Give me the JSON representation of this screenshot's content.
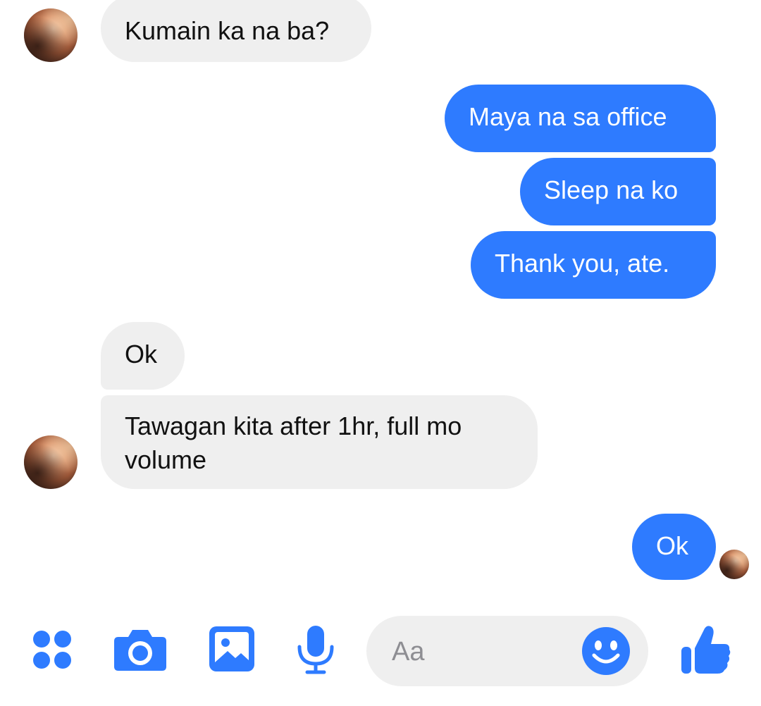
{
  "conversation": {
    "messages": [
      {
        "sender": "contact",
        "text": "Kumain ka na ba?"
      },
      {
        "sender": "me",
        "text": "Maya na sa office"
      },
      {
        "sender": "me",
        "text": "Sleep na ko"
      },
      {
        "sender": "me",
        "text": "Thank you, ate."
      },
      {
        "sender": "contact",
        "text": "Ok"
      },
      {
        "sender": "contact",
        "text": "Tawagan kita after 1hr, full mo"
      },
      {
        "sender": "contact",
        "text": "volume"
      },
      {
        "sender": "me",
        "text": "Ok"
      }
    ]
  },
  "composer": {
    "placeholder": "Aa"
  },
  "toolbar": {
    "icons": [
      "apps-icon",
      "camera-icon",
      "photo-icon",
      "microphone-icon",
      "emoji-icon",
      "thumbs-up-icon"
    ]
  },
  "colors": {
    "accent": "#2e7bff",
    "incoming_bubble": "#efefef",
    "incoming_text": "#111111",
    "outgoing_text": "#ffffff",
    "placeholder_text": "#8e8e93"
  }
}
